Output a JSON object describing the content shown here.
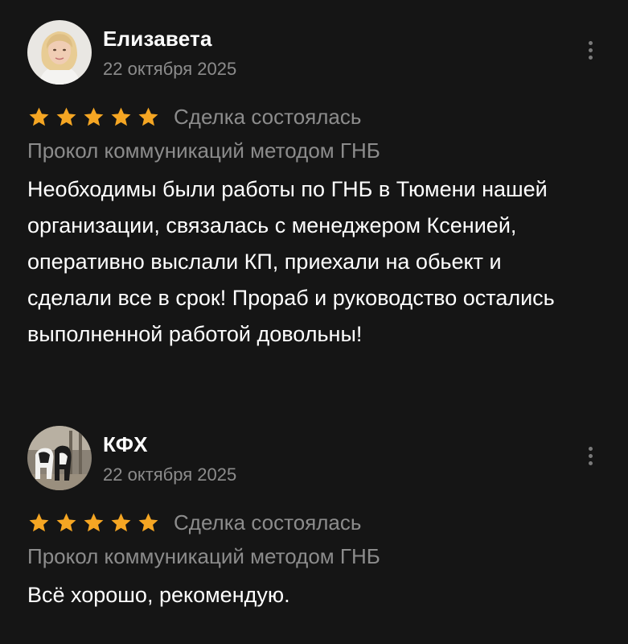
{
  "colors": {
    "background": "#151515",
    "star": "#f5a623",
    "muted_text": "#8c8c8c",
    "primary_text": "#ffffff"
  },
  "reviews": [
    {
      "author": "Елизавета",
      "date": "22 октября 2025",
      "rating": 5,
      "deal_status": "Сделка состоялась",
      "service": "Прокол коммуникаций методом ГНБ",
      "text": "Необходимы были работы по ГНБ в Тюмени нашей организации, связалась с менеджером Ксенией, оперативно выслали КП, приехали на обьект и сделали все в срок! Прораб и руководство остались выполненной работой довольны!",
      "menu_icon": "more-vertical-icon"
    },
    {
      "author": "КФХ",
      "date": "22 октября 2025",
      "rating": 5,
      "deal_status": "Сделка состоялась",
      "service": "Прокол коммуникаций методом ГНБ",
      "text": "Всё хорошо, рекомендую.",
      "menu_icon": "more-vertical-icon"
    }
  ]
}
